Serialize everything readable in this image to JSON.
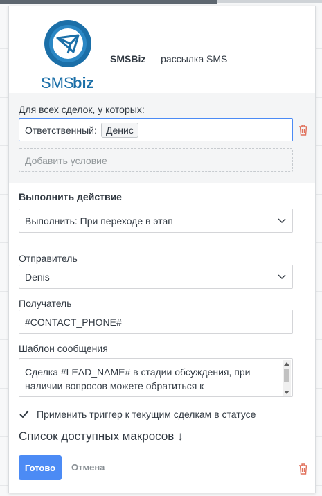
{
  "app": {
    "logo_text_sms": "SMS",
    "logo_text_biz": "biz",
    "name_bold": "SMSBiz",
    "name_rest": " — рассылка SMS"
  },
  "conditions": {
    "heading": "Для всех сделок, у которых:",
    "field_label": "Ответственный:",
    "field_value": "Денис",
    "add_label": "Добавить условие"
  },
  "action": {
    "heading": "Выполнить действие",
    "selected": "Выполнить: При переходе в этап"
  },
  "sender": {
    "label": "Отправитель",
    "selected": "Denis"
  },
  "recipient": {
    "label": "Получатель",
    "value": "#CONTACT_PHONE#"
  },
  "template": {
    "label": "Шаблон сообщения",
    "value": "Сделка #LEAD_NAME# в стадии обсуждения, при наличии вопросов можете обратиться к #RESPONSE_NAME# #RESPONSE_PHONE#"
  },
  "apply_trigger": {
    "label": "Применить триггер к текущим сделкам в статусе",
    "checked": true
  },
  "macros_link": "Список доступных макросов ↓",
  "buttons": {
    "done": "Готово",
    "cancel": "Отмена"
  },
  "colors": {
    "accent": "#4c8bf5",
    "delete": "#e0705b",
    "logo_blue": "#1b6fa8"
  }
}
